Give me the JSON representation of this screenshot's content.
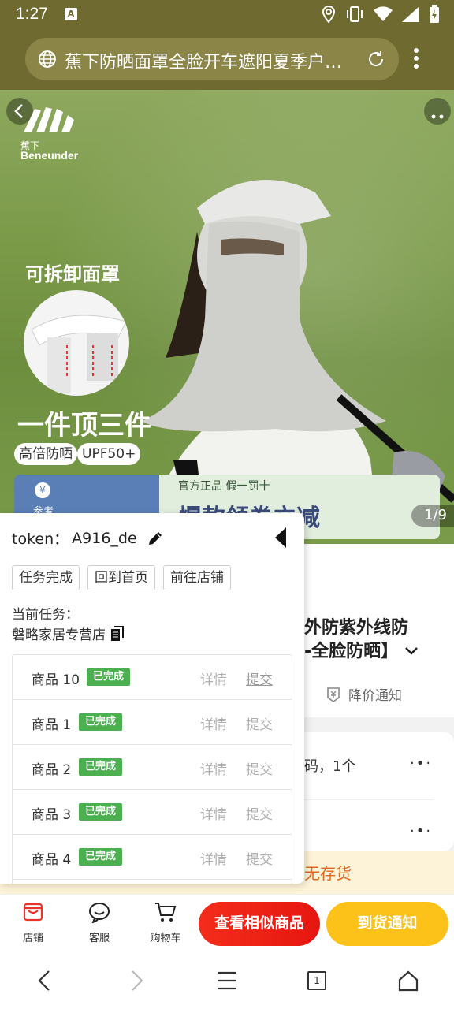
{
  "status_bar": {
    "time": "1:27",
    "app_icon_letter": "A"
  },
  "url_bar": {
    "title": "蕉下防晒面罩全脸开车遮阳夏季户…"
  },
  "hero": {
    "brand_cn": "蕉下",
    "brand_en": "Beneunder",
    "detachable": "可拆卸面罩",
    "one_for_three": "一件顶三件",
    "tag_1": "高倍防晒",
    "tag_2": "UPF50+",
    "promo_coin": "¥",
    "promo_ref": "参考",
    "promo_small": "官方正品 假一罚十",
    "promo_big": "爆款领券立减",
    "page_indicator": "1/9"
  },
  "product": {
    "title_fragment_1": "外防紫外线防",
    "title_fragment_2": "-全脸防晒】",
    "price_notify": "降价通知",
    "spec_fragment": "码，1个",
    "stock_text": "无存货"
  },
  "action_bar": {
    "store_label": "店铺",
    "service_label": "客服",
    "cart_label": "购物车",
    "similar_button": "查看相似商品",
    "arrival_button": "到货通知"
  },
  "panel": {
    "token_label": "token：",
    "token_value": "A916_de",
    "buttons": [
      "任务完成",
      "回到首页",
      "前往店铺"
    ],
    "current_task_label": "当前任务：",
    "current_task_store": "磐略家居专营店",
    "rows": [
      {
        "name": "商品 10",
        "status": "已完成",
        "detail": "详情",
        "submit": "提交"
      },
      {
        "name": "商品 1",
        "status": "已完成",
        "detail": "详情",
        "submit": "提交"
      },
      {
        "name": "商品 2",
        "status": "已完成",
        "detail": "详情",
        "submit": "提交"
      },
      {
        "name": "商品 3",
        "status": "已完成",
        "detail": "详情",
        "submit": "提交"
      },
      {
        "name": "商品 4",
        "status": "已完成",
        "detail": "详情",
        "submit": "提交"
      }
    ]
  },
  "colors": {
    "status_bar": "#6f6b30",
    "badge_green": "#4caf50",
    "similar_red": "#f42d1b",
    "arrival_yellow": "#fdc21a",
    "stock_orange": "#e0671a"
  },
  "icons": [
    "globe-icon",
    "reload-icon",
    "more-vert-icon",
    "edit-icon",
    "collapse-left-icon",
    "copy-icon",
    "store-icon",
    "service-icon",
    "cart-icon",
    "back-nav-icon",
    "forward-nav-icon",
    "menu-nav-icon",
    "tabs-nav-icon",
    "home-nav-icon"
  ],
  "nav_bar": {
    "tab_count": "1"
  }
}
